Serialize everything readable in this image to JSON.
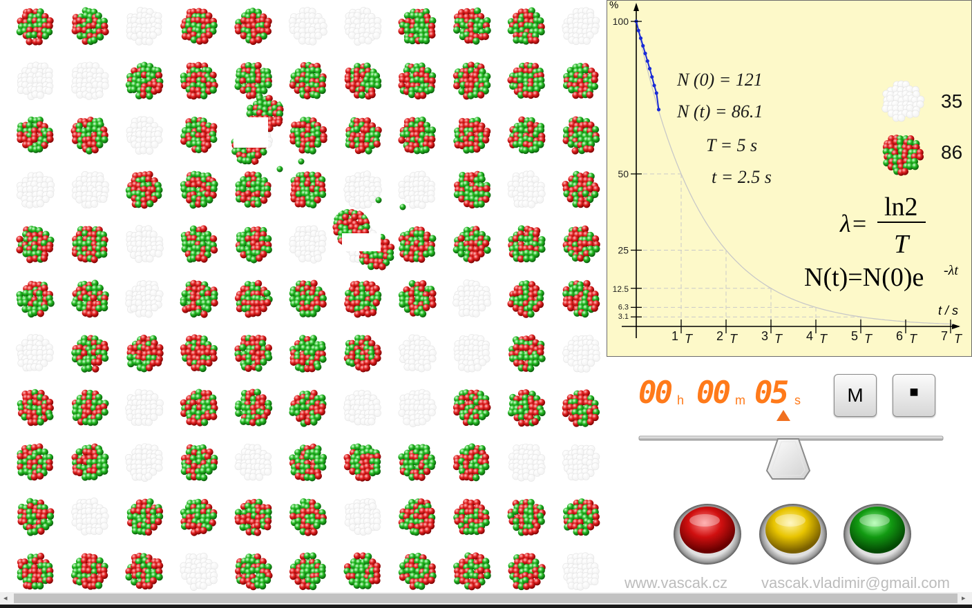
{
  "nuclei_grid": {
    "rows": [
      [
        1,
        1,
        0,
        1,
        1,
        0,
        0,
        1,
        1,
        1,
        0
      ],
      [
        0,
        0,
        1,
        1,
        1,
        1,
        1,
        1,
        1,
        1,
        1
      ],
      [
        1,
        1,
        0,
        1,
        0,
        1,
        1,
        1,
        1,
        1,
        1
      ],
      [
        0,
        0,
        1,
        1,
        1,
        1,
        0,
        0,
        1,
        0,
        1
      ],
      [
        1,
        1,
        0,
        1,
        1,
        0,
        0,
        1,
        1,
        1,
        1
      ],
      [
        1,
        1,
        0,
        1,
        1,
        1,
        1,
        1,
        0,
        1,
        1
      ],
      [
        0,
        1,
        1,
        1,
        1,
        1,
        1,
        0,
        0,
        1,
        0
      ],
      [
        1,
        1,
        0,
        1,
        1,
        1,
        0,
        0,
        1,
        1,
        1
      ],
      [
        1,
        1,
        0,
        1,
        0,
        1,
        1,
        1,
        1,
        0,
        0
      ],
      [
        1,
        0,
        1,
        1,
        1,
        1,
        0,
        1,
        1,
        1,
        1
      ],
      [
        1,
        1,
        1,
        0,
        1,
        1,
        1,
        1,
        1,
        1,
        0
      ]
    ]
  },
  "chart_data": {
    "type": "line",
    "ylabel": "%",
    "xlabel": "t / s",
    "y_ticks": [
      "100",
      "50",
      "25",
      "12.5",
      "6.3",
      "3.1"
    ],
    "y_tick_values": [
      100,
      50,
      25,
      12.5,
      6.25,
      3.125
    ],
    "x_ticks": [
      "1",
      "2",
      "3",
      "4",
      "5",
      "6",
      "7"
    ],
    "x_tick_suffix": "T",
    "series": [
      {
        "kind": "theoretical decay",
        "x_in_T": [
          0,
          0.5,
          1,
          1.5,
          2,
          2.5,
          3,
          3.5,
          4,
          4.5,
          5,
          5.5,
          6,
          6.5,
          7
        ],
        "values_percent": [
          100,
          70.7,
          50,
          35.4,
          25,
          17.7,
          12.5,
          8.8,
          6.25,
          4.4,
          3.1,
          2.2,
          1.6,
          1.1,
          0.8
        ]
      },
      {
        "kind": "measured",
        "x_in_T": [
          0,
          0.05,
          0.1,
          0.15,
          0.2,
          0.25,
          0.3,
          0.35,
          0.4,
          0.45,
          0.5
        ],
        "values_percent": [
          100,
          97,
          94.5,
          92,
          89.5,
          87,
          84.5,
          81.8,
          79,
          76.5,
          71.1
        ]
      }
    ],
    "colors": {
      "theoretical": "#c8c8c8",
      "measured": "#1a2bd6",
      "background": "#fdf9c9"
    }
  },
  "stats": {
    "n0": "N (0) = 121",
    "nt": "N (t) = 86.1",
    "T": "T = 5 s",
    "t": "t = 2.5 s",
    "decayed_count": "35",
    "remaining_count": "86"
  },
  "formulas": {
    "lambda_lhs": "λ=",
    "lambda_num": "ln2",
    "lambda_den": "T",
    "decay_law_main": "N(t)=N(0)e",
    "decay_law_exp": "-λt"
  },
  "timer": {
    "hours": "00",
    "minutes": "00",
    "seconds": "05",
    "h": "h",
    "m": "m",
    "s": "s"
  },
  "buttons": {
    "m_label": "M",
    "stop_label": "■"
  },
  "controls": {
    "red": "#d01010",
    "yellow": "#e8c400",
    "green": "#129a12"
  },
  "footer": {
    "website": "www.vascak.cz",
    "email": "vascak.vladimir@gmail.com"
  },
  "scrollbar": {
    "left_arrow": "◂",
    "right_arrow": "▸"
  }
}
